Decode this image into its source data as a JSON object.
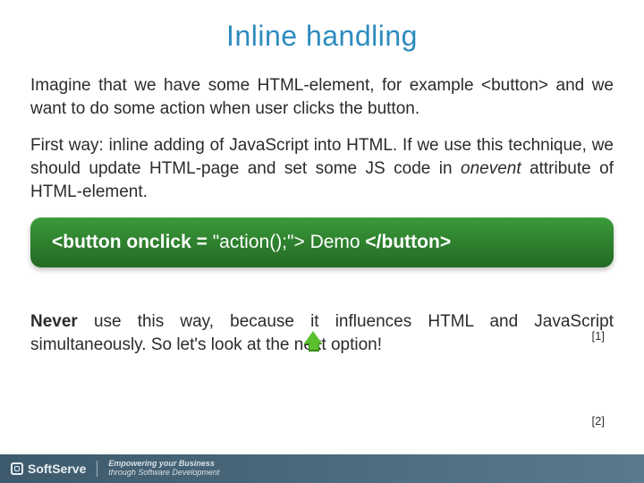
{
  "title": "Inline handling",
  "p1": {
    "a": "Imagine that we have some HTML-element, for example",
    "tag": "<button>",
    "b": "and we want to do some action when user clicks the button."
  },
  "p2": {
    "a": "First way: inline adding of JavaScript into HTML. If we use this technique, we should update HTML-page and set some JS code in",
    "em": "onevent",
    "b": "attribute of HTML-element."
  },
  "code": {
    "strong": "<button onclick = ",
    "mid": "\"action();\"> Demo ",
    "close": "</button>"
  },
  "p3": {
    "strong": "Never",
    "rest": "use this way, because it influences HTML and JavaScript simultaneously. So let's look at the next option!"
  },
  "refs": [
    "[1]",
    "[2]"
  ],
  "footer": {
    "brand": "SoftServe",
    "tag1": "Empowering your Business",
    "tag2": "through Software Development"
  }
}
